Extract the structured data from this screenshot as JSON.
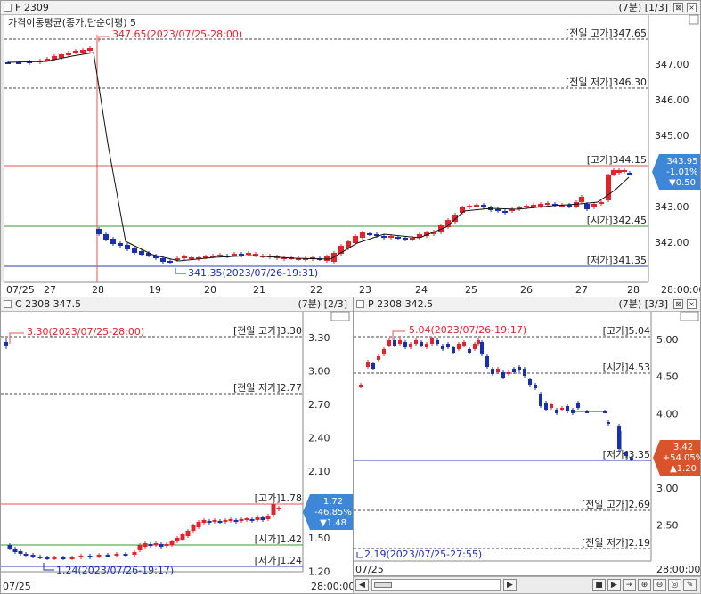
{
  "pane1": {
    "name": "F 2309",
    "frame": "(7분) [1/3]",
    "buttons": [
      "⊠",
      "×"
    ],
    "indicator": "가격이동평균(종가,단순이평) 5",
    "annot_high": "347.65(2023/07/25-28:00)",
    "annot_low": "341.35(2023/07/26-19:31)",
    "levels": [
      {
        "text": "[전일 고가]347.65",
        "v": 347.65,
        "style": "dash"
      },
      {
        "text": "[전일 저가]346.30",
        "v": 346.3,
        "style": "dash"
      },
      {
        "text": "[고가]344.15",
        "v": 344.15,
        "style": "red"
      },
      {
        "text": "[시가]342.45",
        "v": 342.45,
        "style": "green"
      },
      {
        "text": "[저가]341.35",
        "v": 341.35,
        "style": "blue"
      }
    ],
    "yticks": [
      "347.00",
      "346.00",
      "345.00",
      "344.00",
      "343.00",
      "342.00"
    ],
    "xlabels": [
      "07/25",
      "27",
      "28",
      "19",
      "20",
      "21",
      "22",
      "23",
      "24",
      "25",
      "26",
      "27",
      "28"
    ],
    "xtime": "28:00:00",
    "badge": {
      "price": "343.95",
      "pct": "-1.01%",
      "chg": "▼0.50",
      "color": "#3d86d8"
    }
  },
  "pane2": {
    "name": "C 2308 347.5",
    "frame": "(7분) [2/3]",
    "annot_high": "3.30(2023/07/25-28:00)",
    "annot_low": "1.24(2023/07/26-19:17)",
    "levels": [
      {
        "text": "[전일 고가]3.30",
        "style": "dash"
      },
      {
        "text": "[전일 저가]2.77",
        "style": "dash"
      },
      {
        "text": "[고가]1.78",
        "style": "red"
      },
      {
        "text": "[시가]1.42",
        "style": "green"
      },
      {
        "text": "[저가]1.24",
        "style": "blue"
      }
    ],
    "yticks": [
      "3.30",
      "3.00",
      "2.70",
      "2.40",
      "2.10",
      "1.80",
      "1.50",
      "1.20"
    ],
    "xlabels": [
      "07/25"
    ],
    "xtime": "28:00:00",
    "badge": {
      "price": "1.72",
      "pct": "-46.85%",
      "chg": "▼1.48",
      "color": "#3d86d8"
    }
  },
  "pane3": {
    "name": "P 2308 342.5",
    "frame": "(7분) [3/3]",
    "annot_high": "5.04(2023/07/26-19:17)",
    "annot_low": "2.19(2023/07/25-27:55)",
    "levels": [
      {
        "text": "[고가]5.04",
        "style": "dash"
      },
      {
        "text": "[시가]4.53",
        "style": "dash"
      },
      {
        "text": "[저가]3.35",
        "style": "blue"
      },
      {
        "text": "[전일 고가]2.69",
        "style": "dash"
      },
      {
        "text": "[전일 저가]2.19",
        "style": "dash"
      }
    ],
    "yticks": [
      "5.00",
      "4.50",
      "4.00",
      "3.50",
      "3.00",
      "2.50"
    ],
    "xlabels": [
      "07/25"
    ],
    "xtime": "28:00:00",
    "badge": {
      "price": "3.42",
      "pct": "+54.05%",
      "chg": "▲1.20",
      "color": "#d9542b"
    }
  },
  "toolbar": {
    "items": [
      "stepper-icon",
      "stop-icon",
      "play-icon",
      "next-icon",
      "zoom-in-icon",
      "zoom-out-icon",
      "zoom-reset-icon",
      "settings-icon"
    ]
  }
}
